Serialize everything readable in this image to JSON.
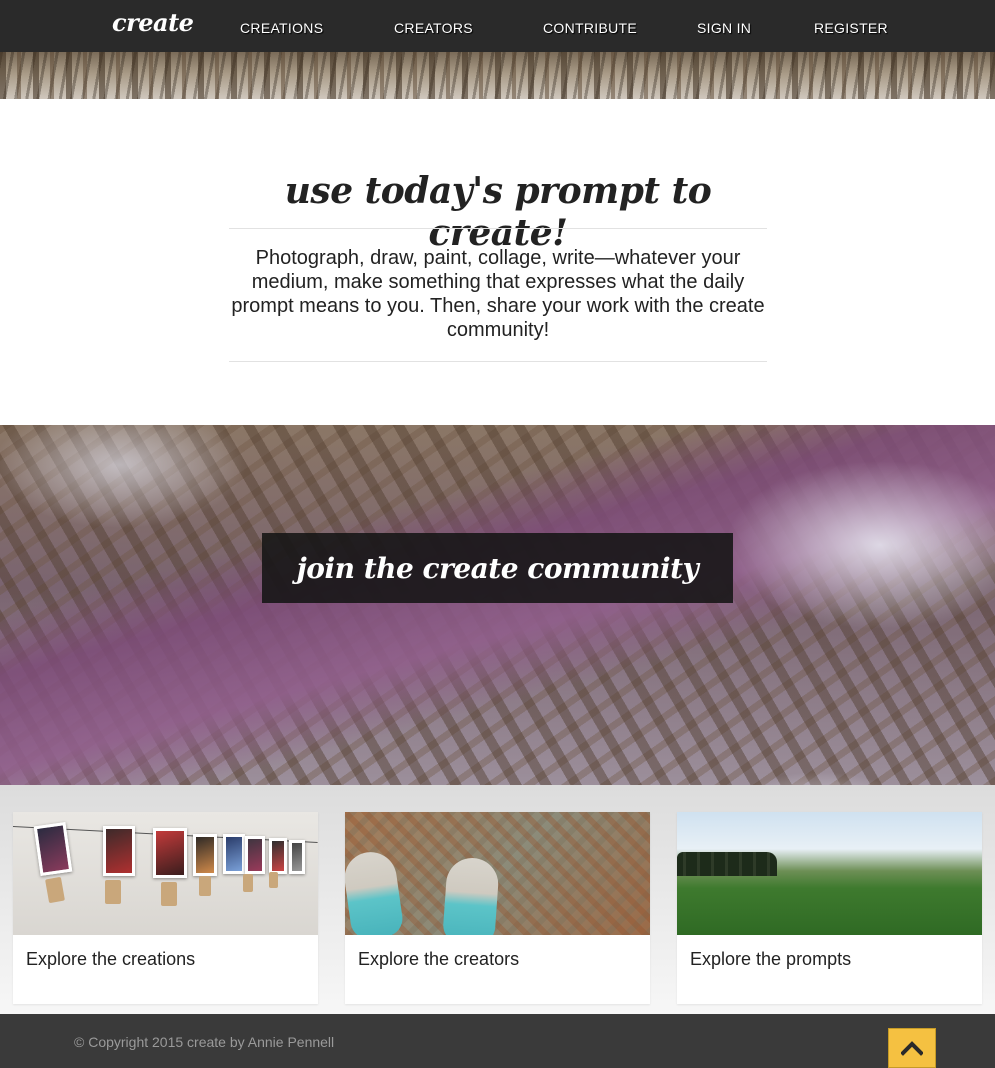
{
  "nav": {
    "brand": "create",
    "links": [
      {
        "label": "CREATIONS"
      },
      {
        "label": "CREATORS"
      },
      {
        "label": "CONTRIBUTE"
      },
      {
        "label": "SIGN IN"
      },
      {
        "label": "REGISTER"
      }
    ]
  },
  "intro": {
    "heading": "use today's prompt to create!",
    "text": "Photograph, draw, paint, collage, write—whatever your medium, make something that expresses what the daily prompt means to you. Then, share your work with the create community!"
  },
  "community": {
    "label": "join the create community"
  },
  "cards": [
    {
      "label": "Explore the creations"
    },
    {
      "label": "Explore the creators"
    },
    {
      "label": "Explore the prompts"
    }
  ],
  "footer": {
    "copyright": "© Copyright 2015 create by Annie Pennell",
    "back_to_top_icon": "chevron-up-icon",
    "accent": "#f5c141"
  }
}
